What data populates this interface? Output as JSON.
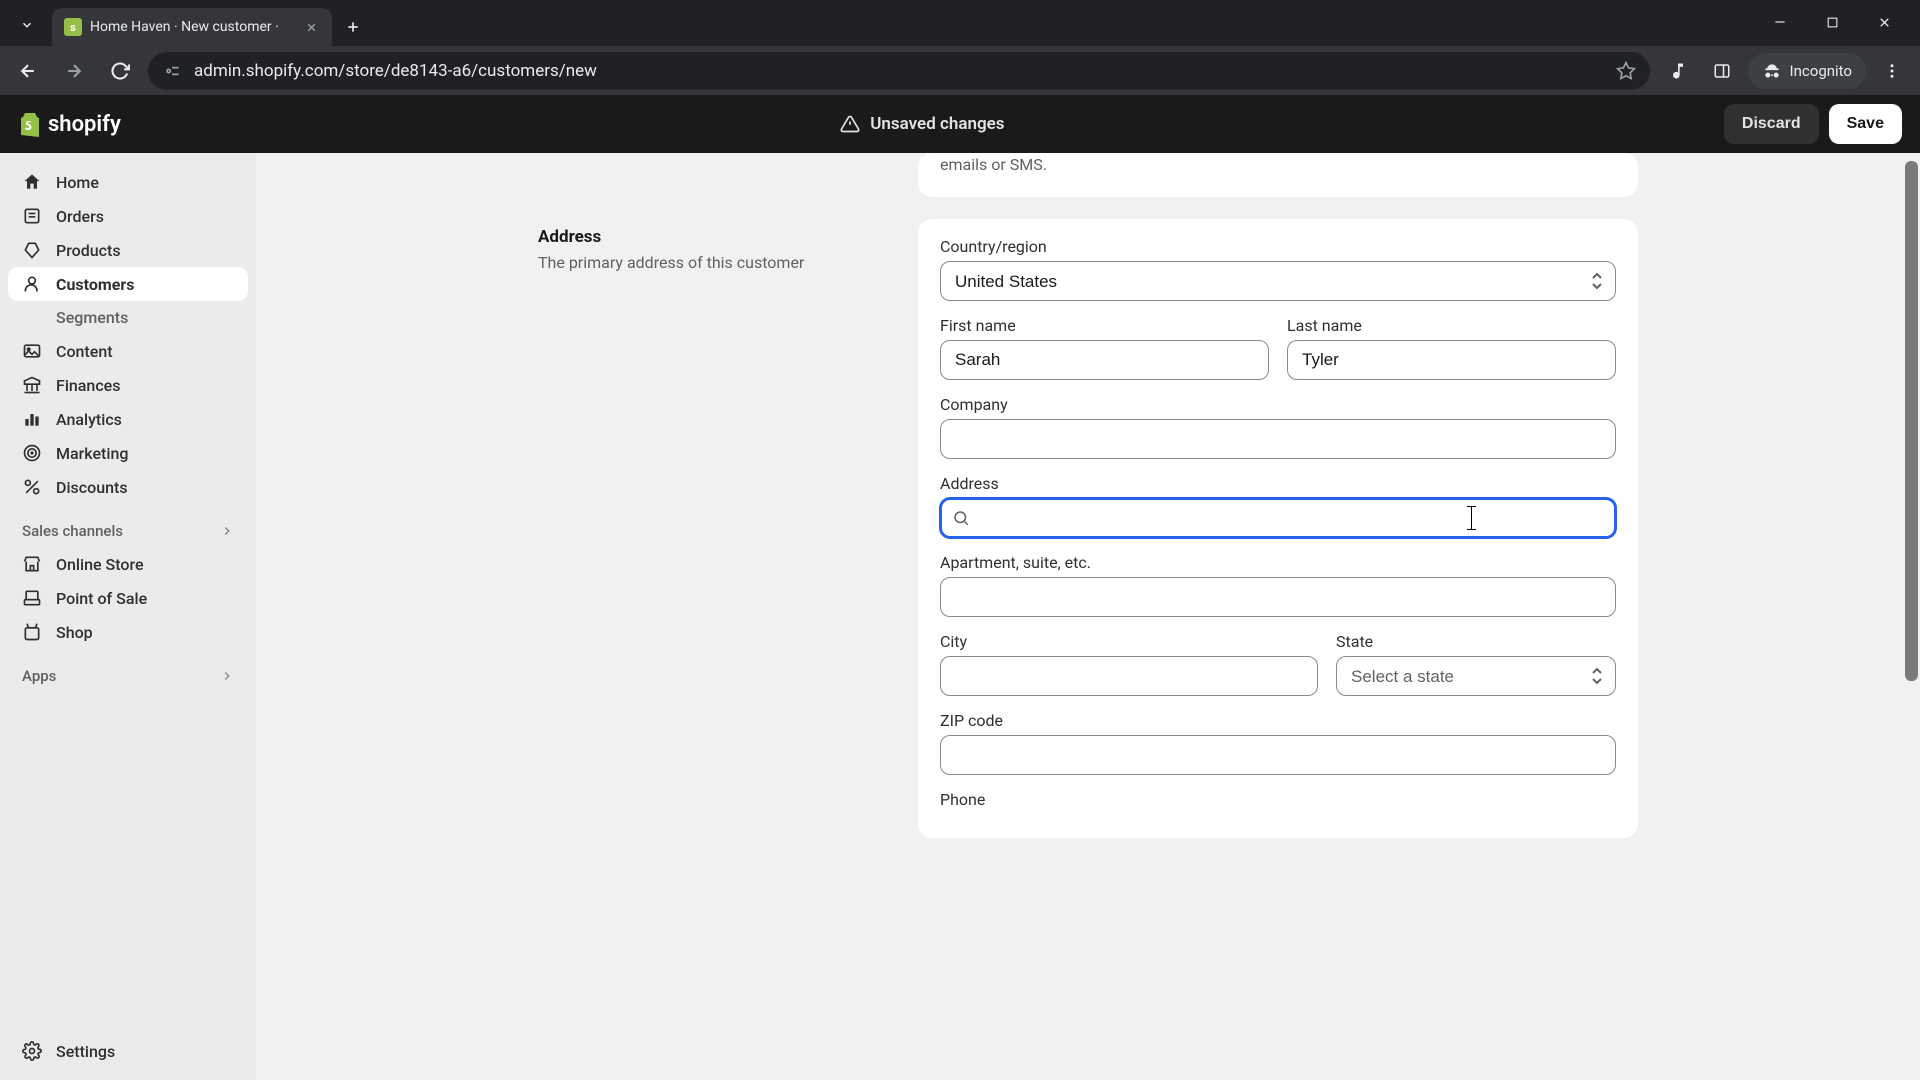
{
  "browser": {
    "tab_title": "Home Haven · New customer ·",
    "url": "admin.shopify.com/store/de8143-a6/customers/new",
    "incognito_label": "Incognito"
  },
  "topbar": {
    "brand": "shopify",
    "unsaved_label": "Unsaved changes",
    "discard_label": "Discard",
    "save_label": "Save"
  },
  "sidebar": {
    "items": [
      {
        "label": "Home",
        "icon": "home"
      },
      {
        "label": "Orders",
        "icon": "orders"
      },
      {
        "label": "Products",
        "icon": "products"
      },
      {
        "label": "Customers",
        "icon": "customers",
        "active": true
      },
      {
        "label": "Segments",
        "sub": true
      },
      {
        "label": "Content",
        "icon": "content"
      },
      {
        "label": "Finances",
        "icon": "finances"
      },
      {
        "label": "Analytics",
        "icon": "analytics"
      },
      {
        "label": "Marketing",
        "icon": "marketing"
      },
      {
        "label": "Discounts",
        "icon": "discounts"
      }
    ],
    "sales_channels_label": "Sales channels",
    "channels": [
      {
        "label": "Online Store"
      },
      {
        "label": "Point of Sale"
      },
      {
        "label": "Shop"
      }
    ],
    "apps_label": "Apps",
    "settings_label": "Settings"
  },
  "info_card_text": "emails or SMS.",
  "section": {
    "title": "Address",
    "description": "The primary address of this customer"
  },
  "form": {
    "country_label": "Country/region",
    "country_value": "United States",
    "first_name_label": "First name",
    "first_name_value": "Sarah",
    "last_name_label": "Last name",
    "last_name_value": "Tyler",
    "company_label": "Company",
    "company_value": "",
    "address_label": "Address",
    "address_value": "",
    "apartment_label": "Apartment, suite, etc.",
    "apartment_value": "",
    "city_label": "City",
    "city_value": "",
    "state_label": "State",
    "state_placeholder": "Select a state",
    "zip_label": "ZIP code",
    "zip_value": "",
    "phone_label": "Phone"
  }
}
